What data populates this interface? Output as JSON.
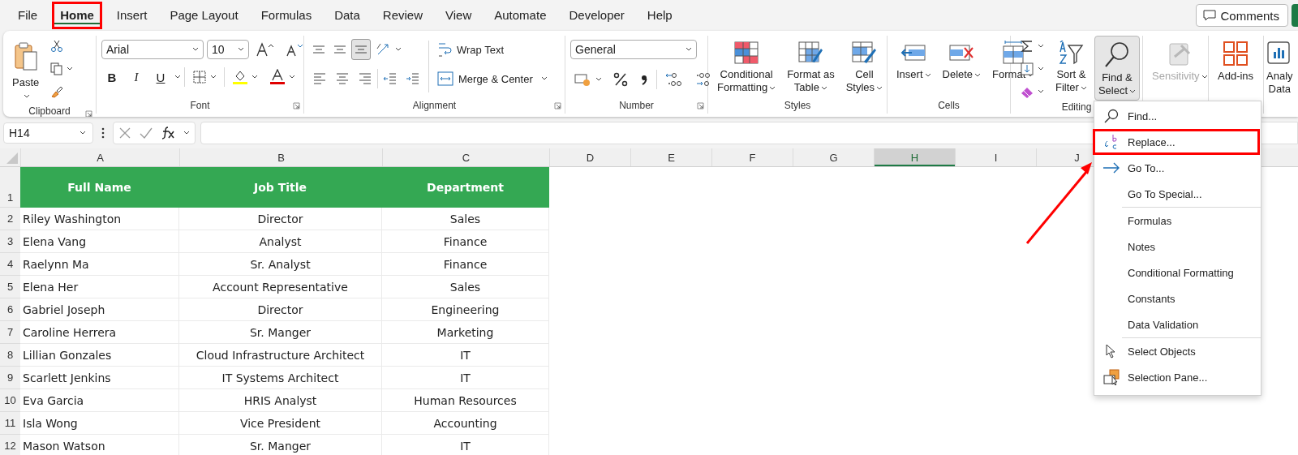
{
  "tabs": [
    {
      "label": "File",
      "selected": false,
      "highlighted": false
    },
    {
      "label": "Home",
      "selected": true,
      "highlighted": true
    },
    {
      "label": "Insert",
      "selected": false,
      "highlighted": false
    },
    {
      "label": "Page Layout",
      "selected": false,
      "highlighted": false
    },
    {
      "label": "Formulas",
      "selected": false,
      "highlighted": false
    },
    {
      "label": "Data",
      "selected": false,
      "highlighted": false
    },
    {
      "label": "Review",
      "selected": false,
      "highlighted": false
    },
    {
      "label": "View",
      "selected": false,
      "highlighted": false
    },
    {
      "label": "Automate",
      "selected": false,
      "highlighted": false
    },
    {
      "label": "Developer",
      "selected": false,
      "highlighted": false
    },
    {
      "label": "Help",
      "selected": false,
      "highlighted": false
    }
  ],
  "comments_button": "Comments",
  "ribbon": {
    "groups": [
      {
        "kind": "clipboard",
        "label": "Clipboard",
        "launcher": true,
        "paste": "Paste"
      },
      {
        "kind": "font",
        "label": "Font",
        "launcher": true,
        "font_name": "Arial",
        "font_size": "10",
        "styles": [
          "B",
          "I",
          "U"
        ]
      },
      {
        "kind": "alignment",
        "label": "Alignment",
        "launcher": true,
        "vertical": [
          {
            "selected": false
          },
          {
            "selected": false
          },
          {
            "selected": true
          }
        ],
        "wrap_text": "Wrap Text",
        "merge": "Merge & Center"
      },
      {
        "kind": "number",
        "label": "Number",
        "launcher": true,
        "format": "General"
      },
      {
        "kind": "large",
        "label": "Styles",
        "commands": [
          {
            "lines": [
              "Conditional",
              "Formatting"
            ],
            "dropdown": true,
            "disabled": false,
            "expanded": false
          },
          {
            "lines": [
              "Format as",
              "Table"
            ],
            "dropdown": true,
            "disabled": false,
            "expanded": false
          },
          {
            "lines": [
              "Cell",
              "Styles"
            ],
            "dropdown": true,
            "disabled": false,
            "expanded": false
          }
        ]
      },
      {
        "kind": "large",
        "label": "Cells",
        "commands": [
          {
            "lines": [
              "Insert"
            ],
            "dropdown": true,
            "disabled": false,
            "expanded": false
          },
          {
            "lines": [
              "Delete"
            ],
            "dropdown": true,
            "disabled": false,
            "expanded": false
          },
          {
            "lines": [
              "Format"
            ],
            "dropdown": true,
            "disabled": false,
            "expanded": false
          }
        ]
      },
      {
        "kind": "editing",
        "label": "Editing",
        "commands": [
          {
            "lines": [
              "Sort &",
              "Filter"
            ],
            "dropdown": true,
            "disabled": false,
            "expanded": false
          },
          {
            "lines": [
              "Find &",
              "Select"
            ],
            "dropdown": true,
            "disabled": false,
            "expanded": true
          }
        ]
      },
      {
        "kind": "large",
        "commands": [
          {
            "lines": [
              "Sensitivity"
            ],
            "dropdown": true,
            "disabled": true,
            "expanded": false
          }
        ]
      },
      {
        "kind": "large",
        "commands": [
          {
            "lines": [
              "Add-ins"
            ],
            "disabled": false,
            "expanded": false
          }
        ]
      },
      {
        "kind": "large",
        "commands": [
          {
            "lines": [
              "Analy",
              "Data"
            ],
            "disabled": false,
            "expanded": false
          }
        ]
      }
    ]
  },
  "name_box": "H14",
  "sheet": {
    "columns": [
      {
        "label": "A",
        "selected": false
      },
      {
        "label": "B",
        "selected": false
      },
      {
        "label": "C",
        "selected": false
      },
      {
        "label": "D",
        "selected": false
      },
      {
        "label": "E",
        "selected": false
      },
      {
        "label": "F",
        "selected": false
      },
      {
        "label": "G",
        "selected": false
      },
      {
        "label": "H",
        "selected": true
      },
      {
        "label": "I",
        "selected": false
      },
      {
        "label": "J",
        "selected": false
      }
    ],
    "header_row": {
      "number": "1",
      "cells": [
        "Full Name",
        "Job Title",
        "Department"
      ]
    },
    "rows": [
      {
        "number": "2",
        "cells": [
          "Riley Washington",
          "Director",
          "Sales"
        ]
      },
      {
        "number": "3",
        "cells": [
          "Elena Vang",
          "Analyst",
          "Finance"
        ]
      },
      {
        "number": "4",
        "cells": [
          "Raelynn Ma",
          "Sr. Analyst",
          "Finance"
        ]
      },
      {
        "number": "5",
        "cells": [
          "Elena Her",
          "Account Representative",
          "Sales"
        ]
      },
      {
        "number": "6",
        "cells": [
          "Gabriel Joseph",
          "Director",
          "Engineering"
        ]
      },
      {
        "number": "7",
        "cells": [
          "Caroline Herrera",
          "Sr. Manger",
          "Marketing"
        ]
      },
      {
        "number": "8",
        "cells": [
          "Lillian Gonzales",
          "Cloud Infrastructure Architect",
          "IT"
        ]
      },
      {
        "number": "9",
        "cells": [
          "Scarlett Jenkins",
          "IT Systems Architect",
          "IT"
        ]
      },
      {
        "number": "10",
        "cells": [
          "Eva Garcia",
          "HRIS Analyst",
          "Human Resources"
        ]
      },
      {
        "number": "11",
        "cells": [
          "Isla Wong",
          "Vice President",
          "Accounting"
        ]
      },
      {
        "number": "12",
        "cells": [
          "Mason Watson",
          "Sr. Manger",
          "IT"
        ]
      }
    ]
  },
  "menu": {
    "items": [
      {
        "kind": "search",
        "label": "Find...",
        "highlighted": false
      },
      {
        "kind": "replace",
        "label": "Replace...",
        "highlighted": true
      },
      {
        "kind": "arrow",
        "label": "Go To...",
        "highlighted": false
      },
      {
        "kind": "plain",
        "label": "Go To Special...",
        "highlighted": false
      },
      {
        "kind": "separator"
      },
      {
        "kind": "plain",
        "label": "Formulas",
        "highlighted": false
      },
      {
        "kind": "plain",
        "label": "Notes",
        "highlighted": false
      },
      {
        "kind": "plain",
        "label": "Conditional Formatting",
        "highlighted": false
      },
      {
        "kind": "plain",
        "label": "Constants",
        "highlighted": false
      },
      {
        "kind": "plain",
        "label": "Data Validation",
        "highlighted": false
      },
      {
        "kind": "separator"
      },
      {
        "kind": "pointer",
        "label": "Select Objects",
        "highlighted": false
      },
      {
        "kind": "pane",
        "label": "Selection Pane...",
        "highlighted": false
      }
    ]
  },
  "annotation_arrow": true
}
